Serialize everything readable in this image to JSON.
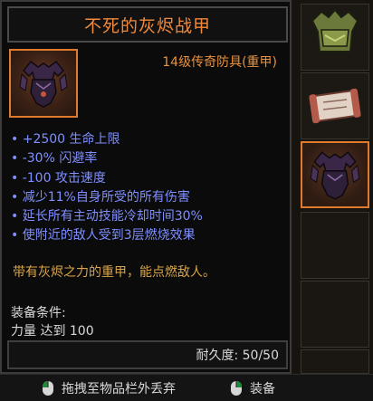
{
  "tooltip": {
    "title": "不死的灰烬战甲",
    "item_type": "14级传奇防具(重甲)",
    "stats": [
      "• +2500 生命上限",
      "• -30% 闪避率",
      "• -100 攻击速度",
      "• 减少11%自身所受的所有伤害",
      "• 延长所有主动技能冷却时间30%",
      "• 使附近的敌人受到3层燃烧效果"
    ],
    "flavor_text": "带有灰烬之力的重甲，能点燃敌人。",
    "requirements_label": "装备条件:",
    "requirements_value": "力量 达到 100",
    "durability": "耐久度: 50/50"
  },
  "actions": {
    "drop_label": "拖拽至物品栏外丢弃",
    "equip_label": "装备"
  },
  "inventory": {
    "slots": [
      "crown-armor-icon",
      "scroll-icon",
      "ashen-armor-icon",
      "",
      "",
      ""
    ]
  },
  "colors": {
    "title": "#f08a3e",
    "stat": "#7f8fff",
    "flavor": "#d8a54a",
    "accent_border": "#e07a2c"
  }
}
